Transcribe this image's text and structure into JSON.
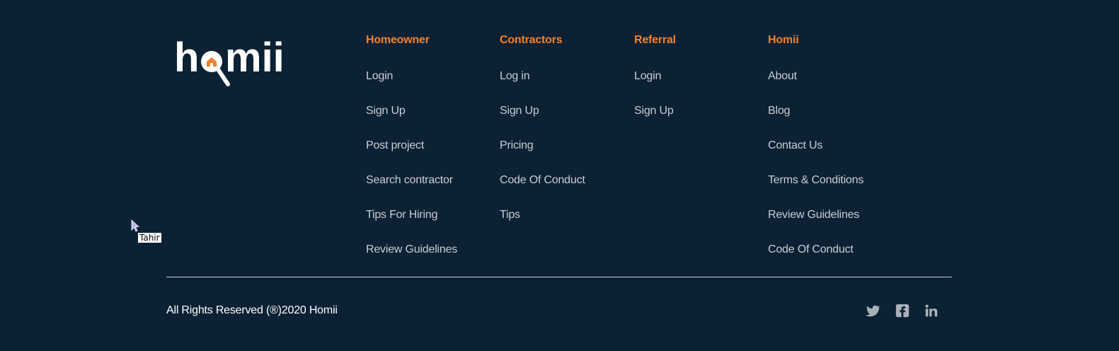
{
  "brand": {
    "logo_text_left": "h",
    "logo_text_right": "mii",
    "accent_color": "#f5822a",
    "background_color": "#0c2133"
  },
  "columns": [
    {
      "heading": "Homeowner",
      "links": [
        "Login",
        "Sign Up",
        "Post project",
        "Search contractor",
        "Tips For Hiring",
        "Review Guidelines"
      ]
    },
    {
      "heading": "Contractors",
      "links": [
        "Log in",
        "Sign Up",
        "Pricing",
        "Code Of Conduct",
        "Tips"
      ]
    },
    {
      "heading": "Referral",
      "links": [
        "Login",
        "Sign Up"
      ]
    },
    {
      "heading": "Homii",
      "links": [
        "About",
        "Blog",
        "Contact Us",
        "Terms & Conditions",
        "Review Guidelines",
        "Code Of Conduct"
      ]
    }
  ],
  "footer": {
    "copyright": "All Rights Reserved (®)2020 Homii",
    "social": [
      "twitter-icon",
      "facebook-icon",
      "linkedin-icon"
    ]
  },
  "tooltip": {
    "text": "Tahir"
  }
}
